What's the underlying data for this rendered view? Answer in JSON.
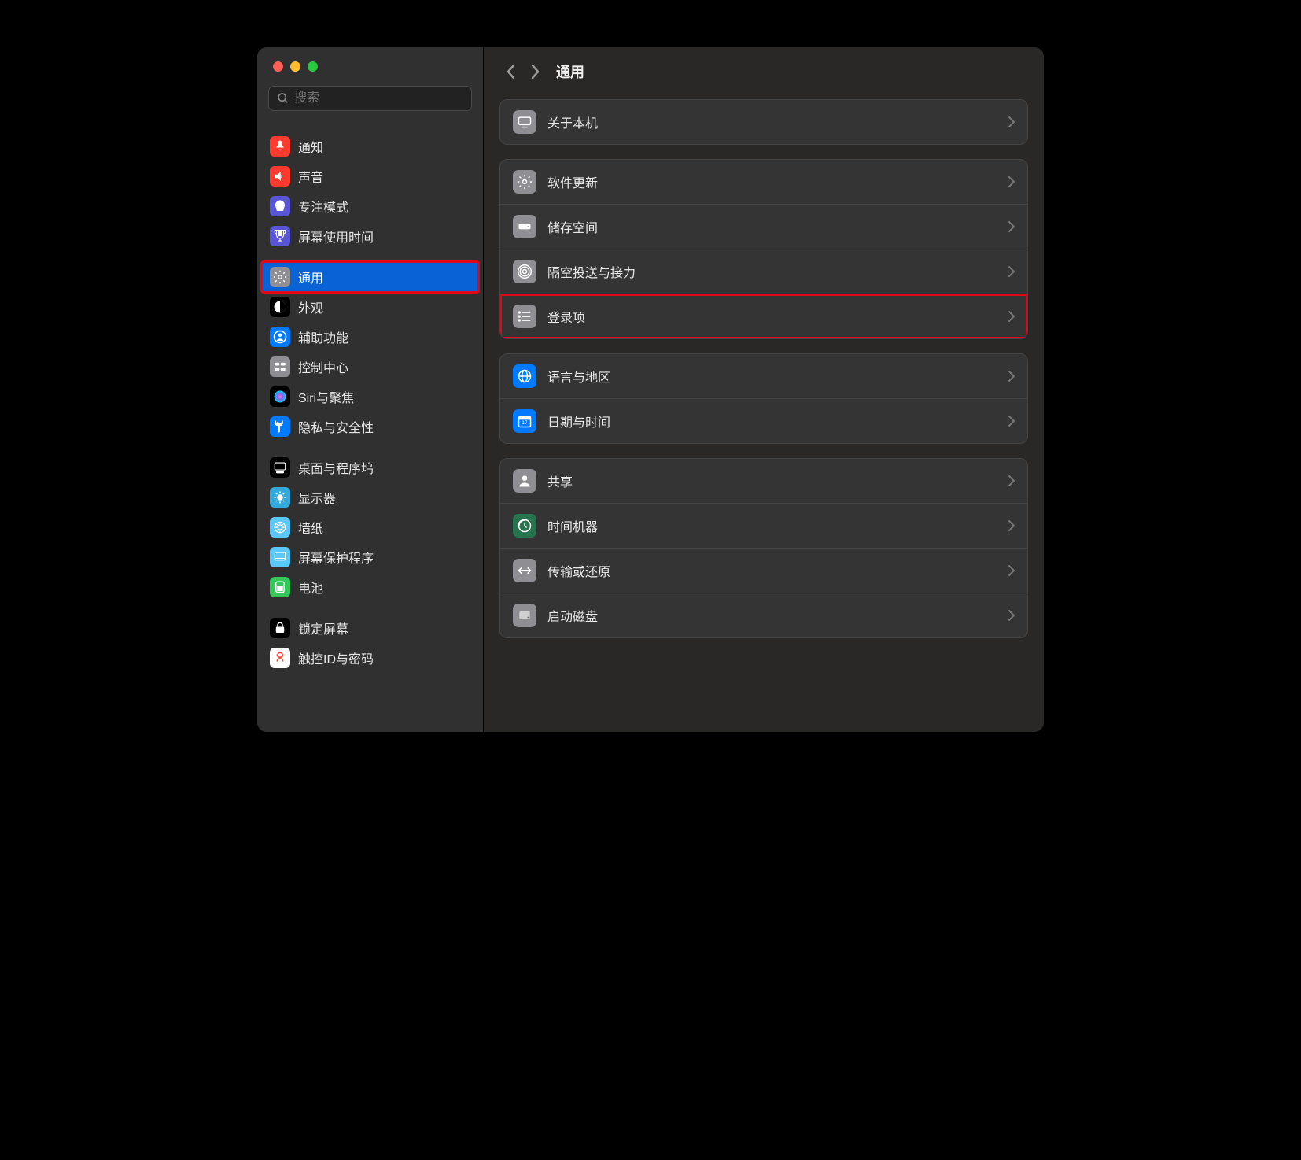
{
  "search": {
    "placeholder": "搜索"
  },
  "sidebar": {
    "items": [
      {
        "label": "通知",
        "bg": "#ff3b30"
      },
      {
        "label": "声音",
        "bg": "#ff3b30"
      },
      {
        "label": "专注模式",
        "bg": "#5856d6"
      },
      {
        "label": "屏幕使用时间",
        "bg": "#5856d6"
      },
      {
        "label": "通用",
        "bg": "#8e8e93",
        "selected": true,
        "highlight": true
      },
      {
        "label": "外观",
        "bg": "#000000"
      },
      {
        "label": "辅助功能",
        "bg": "#007aff"
      },
      {
        "label": "控制中心",
        "bg": "#8e8e93"
      },
      {
        "label": "Siri与聚焦",
        "bg": "#000000"
      },
      {
        "label": "隐私与安全性",
        "bg": "#007aff"
      },
      {
        "label": "桌面与程序坞",
        "bg": "#000000"
      },
      {
        "label": "显示器",
        "bg": "#34aadc"
      },
      {
        "label": "墙纸",
        "bg": "#5ac8fa"
      },
      {
        "label": "屏幕保护程序",
        "bg": "#5ac8fa"
      },
      {
        "label": "电池",
        "bg": "#34c759"
      },
      {
        "label": "锁定屏幕",
        "bg": "#000000"
      },
      {
        "label": "触控ID与密码",
        "bg": "#ffffff"
      }
    ]
  },
  "main": {
    "title": "通用",
    "sections": [
      {
        "rows": [
          {
            "label": "关于本机",
            "icon": "display",
            "bg": "#8e8e93"
          }
        ]
      },
      {
        "rows": [
          {
            "label": "软件更新",
            "icon": "gear",
            "bg": "#8e8e93"
          },
          {
            "label": "储存空间",
            "icon": "disk",
            "bg": "#8e8e93"
          },
          {
            "label": "隔空投送与接力",
            "icon": "airdrop",
            "bg": "#8e8e93"
          },
          {
            "label": "登录项",
            "icon": "list",
            "bg": "#8e8e93",
            "highlight": true
          }
        ]
      },
      {
        "rows": [
          {
            "label": "语言与地区",
            "icon": "globe",
            "bg": "#007aff"
          },
          {
            "label": "日期与时间",
            "icon": "calendar",
            "bg": "#007aff"
          }
        ]
      },
      {
        "rows": [
          {
            "label": "共享",
            "icon": "person",
            "bg": "#8e8e93"
          },
          {
            "label": "时间机器",
            "icon": "tm",
            "bg": "#26734d"
          },
          {
            "label": "传输或还原",
            "icon": "arrows",
            "bg": "#8e8e93"
          },
          {
            "label": "启动磁盘",
            "icon": "hdd",
            "bg": "#8e8e93"
          }
        ]
      }
    ]
  }
}
